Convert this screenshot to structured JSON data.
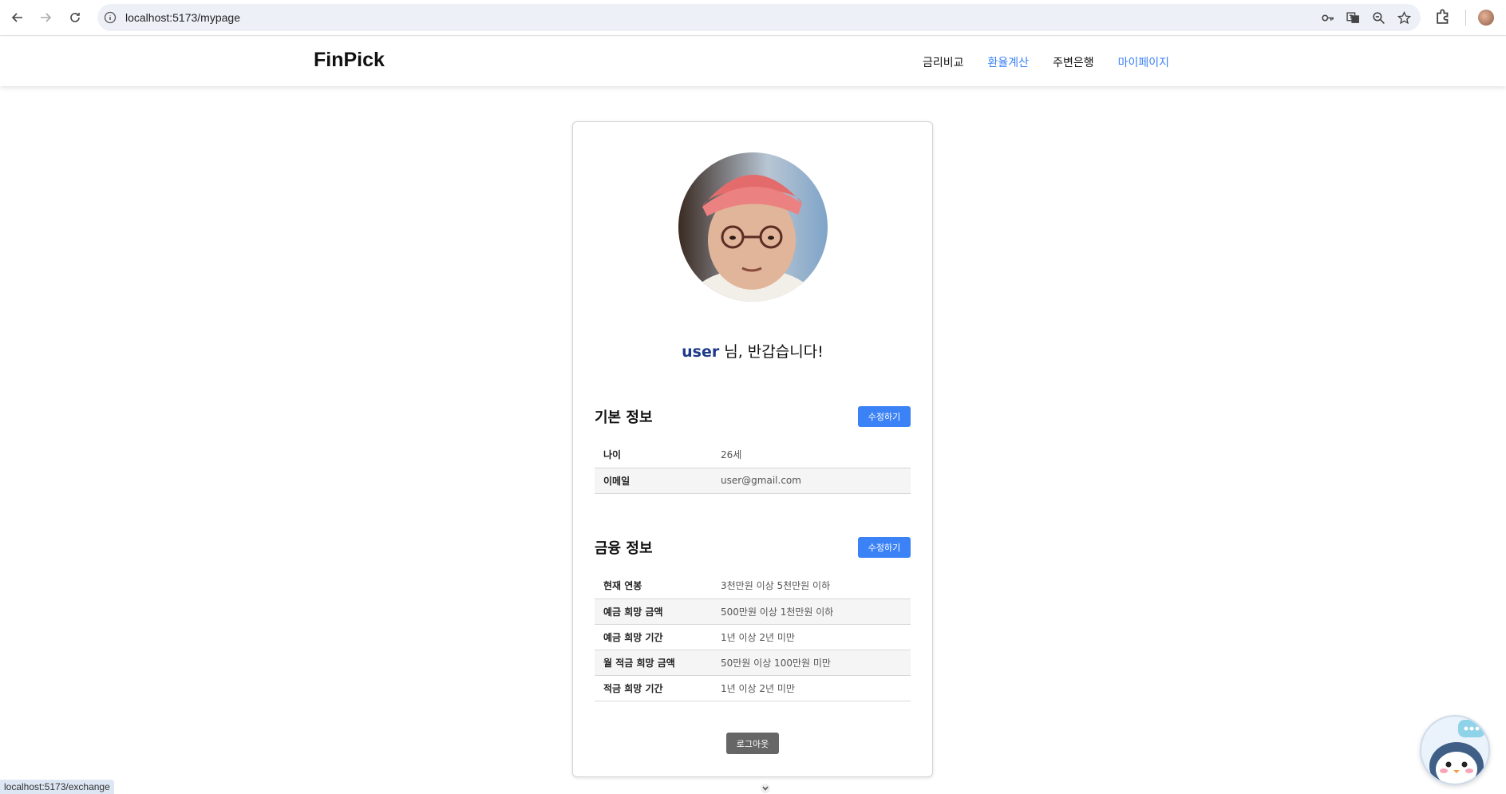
{
  "browser": {
    "url": "localhost:5173/mypage",
    "status_url": "localhost:5173/exchange"
  },
  "site": {
    "logo": "FinPick",
    "nav": [
      {
        "label": "금리비교",
        "active": false
      },
      {
        "label": "환율계산",
        "active": true
      },
      {
        "label": "주변은행",
        "active": false
      },
      {
        "label": "마이페이지",
        "active": true
      }
    ]
  },
  "profile": {
    "username": "user",
    "greeting_suffix": "님, 반갑습니다!"
  },
  "basic_info": {
    "title": "기본 정보",
    "edit_label": "수정하기",
    "rows": [
      {
        "key": "나이",
        "value": "26세"
      },
      {
        "key": "이메일",
        "value": "user@gmail.com"
      }
    ]
  },
  "finance_info": {
    "title": "금융 정보",
    "edit_label": "수정하기",
    "rows": [
      {
        "key": "현재 연봉",
        "value": "3천만원 이상 5천만원 이하"
      },
      {
        "key": "예금 희망 금액",
        "value": "500만원 이상 1천만원 이하"
      },
      {
        "key": "예금 희망 기간",
        "value": "1년 이상 2년 미만"
      },
      {
        "key": "월 적금 희망 금액",
        "value": "50만원 이상 100만원 미만"
      },
      {
        "key": "적금 희망 기간",
        "value": "1년 이상 2년 미만"
      }
    ]
  },
  "logout_label": "로그아웃",
  "colors": {
    "accent": "#3b82f6",
    "username": "#1e3a8a",
    "logout": "#666666"
  }
}
